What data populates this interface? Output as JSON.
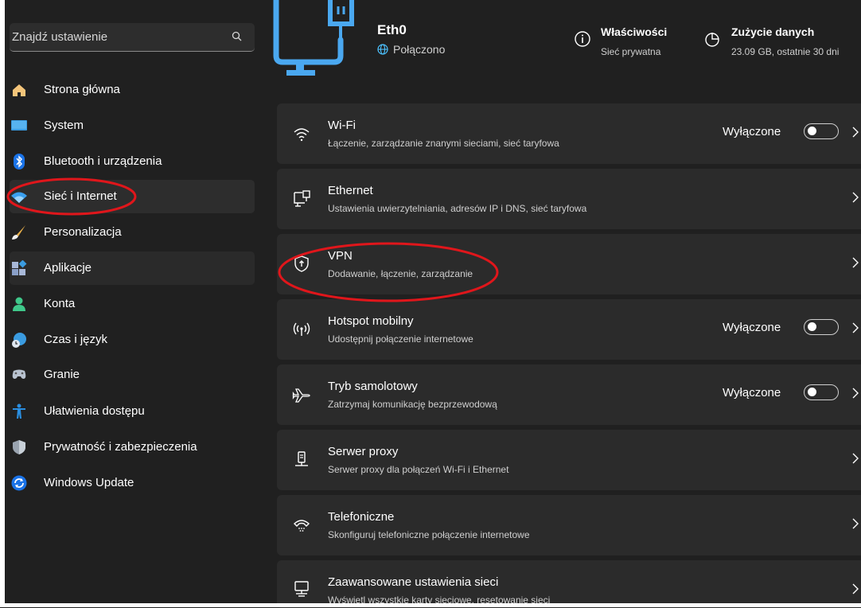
{
  "search": {
    "placeholder": "Znajdź ustawienie"
  },
  "sidebar": {
    "items": [
      {
        "label": "Strona główna",
        "icon": "home-icon"
      },
      {
        "label": "System",
        "icon": "monitor-icon"
      },
      {
        "label": "Bluetooth i urządzenia",
        "icon": "bluetooth-icon"
      },
      {
        "label": "Sieć i Internet",
        "icon": "wifi-icon",
        "active": true
      },
      {
        "label": "Personalizacja",
        "icon": "brush-icon"
      },
      {
        "label": "Aplikacje",
        "icon": "apps-icon"
      },
      {
        "label": "Konta",
        "icon": "person-icon"
      },
      {
        "label": "Czas i język",
        "icon": "clock-globe-icon"
      },
      {
        "label": "Granie",
        "icon": "gamepad-icon"
      },
      {
        "label": "Ułatwienia dostępu",
        "icon": "accessibility-icon"
      },
      {
        "label": "Prywatność i zabezpieczenia",
        "icon": "shield-icon"
      },
      {
        "label": "Windows Update",
        "icon": "refresh-icon"
      }
    ]
  },
  "header": {
    "connection_name": "Eth0",
    "connection_status": "Połączono",
    "properties_title": "Właściwości",
    "properties_sub": "Sieć prywatna",
    "usage_title": "Zużycie danych",
    "usage_sub": "23.09 GB, ostatnie 30 dni"
  },
  "cards": [
    {
      "title": "Wi-Fi",
      "sub": "Łączenie, zarządzanie znanymi sieciami, sieć taryfowa",
      "toggle": "Wyłączone",
      "icon": "wifi-icon"
    },
    {
      "title": "Ethernet",
      "sub": "Ustawienia uwierzytelniania, adresów IP i DNS, sieć taryfowa",
      "icon": "ethernet-icon"
    },
    {
      "title": "VPN",
      "sub": "Dodawanie, łączenie, zarządzanie",
      "icon": "vpn-shield-icon"
    },
    {
      "title": "Hotspot mobilny",
      "sub": "Udostępnij połączenie internetowe",
      "toggle": "Wyłączone",
      "icon": "hotspot-icon"
    },
    {
      "title": "Tryb samolotowy",
      "sub": "Zatrzymaj komunikację bezprzewodową",
      "toggle": "Wyłączone",
      "icon": "airplane-icon"
    },
    {
      "title": "Serwer proxy",
      "sub": "Serwer proxy dla połączeń Wi-Fi i Ethernet",
      "icon": "proxy-icon"
    },
    {
      "title": "Telefoniczne",
      "sub": "Skonfiguruj telefoniczne połączenie internetowe",
      "icon": "dialup-icon"
    },
    {
      "title": "Zaawansowane ustawienia sieci",
      "sub": "Wyświetl wszystkie karty sieciowe, resetowanie sieci",
      "icon": "network-adapter-icon"
    }
  ],
  "colors": {
    "background": "#202020",
    "card": "#2b2b2b",
    "accent": "#4cc2ff",
    "annotation": "#e0161b"
  }
}
